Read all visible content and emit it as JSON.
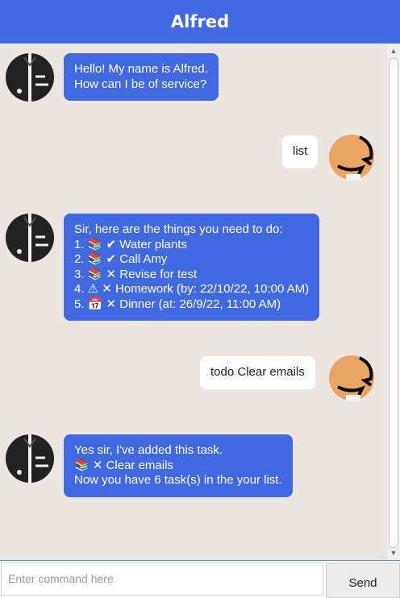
{
  "window": {
    "title": "Alfred"
  },
  "messages": [
    {
      "from": "bot",
      "lines": [
        "Hello! My name is Alfred.",
        "How can I be of service?"
      ]
    },
    {
      "from": "user",
      "lines": [
        "list"
      ]
    },
    {
      "from": "bot",
      "lines": [
        "Sir, here are the things you need to do:",
        "1.  📚  ✔  Water plants",
        "2.  📚  ✔  Call Amy",
        "3.  📚  ✕  Revise for test",
        "4.  ⚠  ✕  Homework (by: 22/10/22, 10:00 AM)",
        "5.  📅  ✕  Dinner (at: 26/9/22, 11:00 AM)"
      ]
    },
    {
      "from": "user",
      "lines": [
        "todo Clear emails"
      ]
    },
    {
      "from": "bot",
      "lines": [
        "Yes sir, I've added this task.",
        "  📚  ✕   Clear emails",
        "Now you have 6 task(s) in the your list."
      ]
    }
  ],
  "input": {
    "placeholder": "Enter command here",
    "value": ""
  },
  "send_button": {
    "label": "Send"
  },
  "icons": {
    "bot_avatar": "butler-avatar-icon",
    "user_avatar": "user-avatar-icon"
  },
  "colors": {
    "accent": "#4169e1",
    "chat_bg": "#ece6e1",
    "user_bubble": "#ffffff"
  }
}
